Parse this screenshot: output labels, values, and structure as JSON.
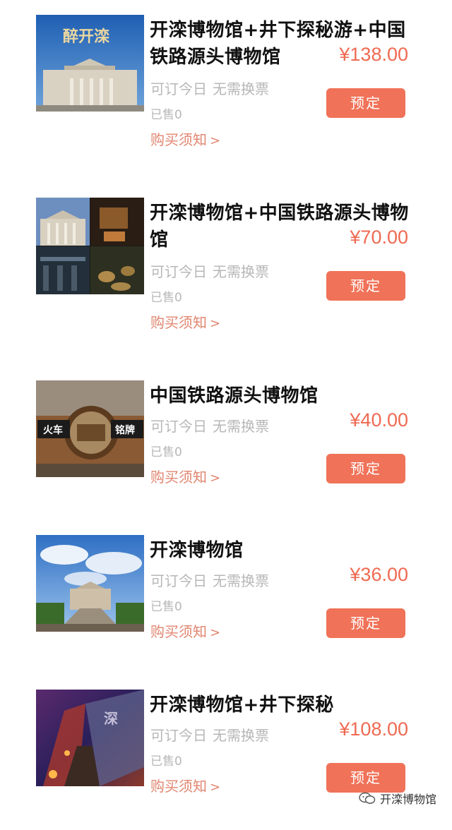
{
  "products": [
    {
      "title": "开滦博物馆+井下探秘游+中国铁路源头博物馆",
      "price": "¥138.00",
      "tag_1": "可订今日",
      "tag_2": "无需换票",
      "sold": "已售0",
      "notice": "购买须知",
      "notice_arrow": ">",
      "button": "预定",
      "image": "museum-facade-photo"
    },
    {
      "title": "开滦博物馆+中国铁路源头博物馆",
      "price": "¥70.00",
      "tag_1": "可订今日",
      "tag_2": "无需换票",
      "sold": "已售0",
      "notice": "购买须知",
      "notice_arrow": ">",
      "button": "预定",
      "image": "museum-collage-photo"
    },
    {
      "title": "中国铁路源头博物馆",
      "price": "¥40.00",
      "tag_1": "可订今日",
      "tag_2": "无需换票",
      "sold": "已售0",
      "notice": "购买须知",
      "notice_arrow": ">",
      "button": "预定",
      "image": "train-nameplates-photo",
      "image_text_1": "火车",
      "image_text_2": "铭牌"
    },
    {
      "title": "开滦博物馆",
      "price": "¥36.00",
      "tag_1": "可订今日",
      "tag_2": "无需换票",
      "sold": "已售0",
      "notice": "购买须知",
      "notice_arrow": ">",
      "button": "预定",
      "image": "museum-plaza-sky-photo"
    },
    {
      "title": "开滦博物馆+井下探秘",
      "price": "¥108.00",
      "tag_1": "可订今日",
      "tag_2": "无需换票",
      "sold": "已售0",
      "notice": "购买须知",
      "notice_arrow": ">",
      "button": "预定",
      "image": "underground-tunnel-photo"
    }
  ],
  "watermark": {
    "text": "开滦博物馆",
    "icon": "wechat-icon"
  },
  "colors": {
    "price": "#ef6a52",
    "button_bg": "#f07258",
    "notice": "#e0856f",
    "muted": "#b7b7b7",
    "title": "#111111"
  }
}
